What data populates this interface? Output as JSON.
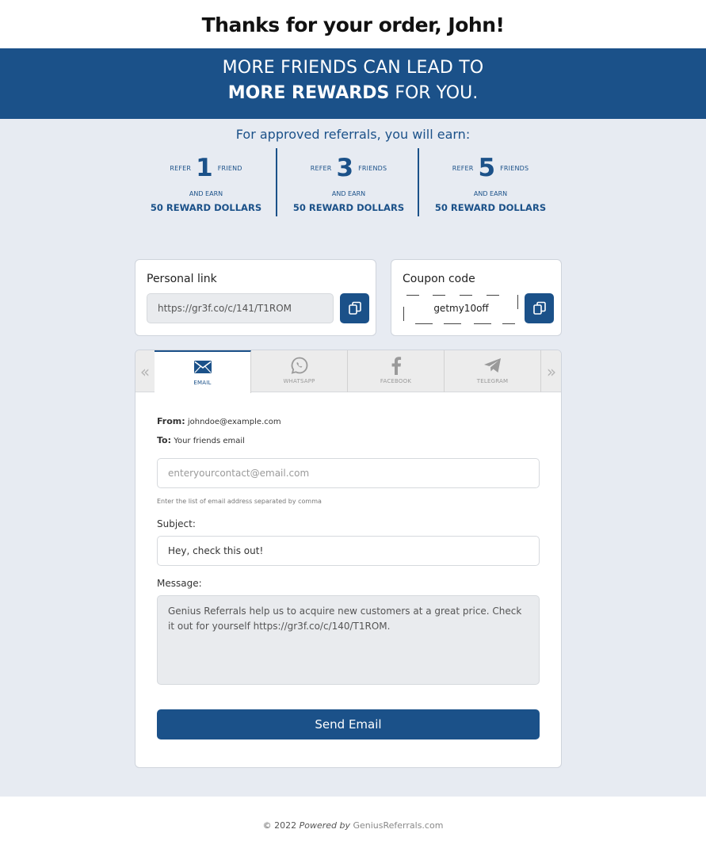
{
  "page": {
    "title": "Thanks for your order, John!"
  },
  "banner": {
    "line1": "MORE FRIENDS CAN LEAD TO",
    "line2_bold": "MORE REWARDS",
    "line2_rest": " FOR YOU."
  },
  "rewards": {
    "intro": "For approved referrals, you will earn:",
    "tiers": [
      {
        "refer": "REFER",
        "count": "1",
        "unit": "FRIEND",
        "and_earn": "AND EARN",
        "reward": "50 REWARD DOLLARS"
      },
      {
        "refer": "REFER",
        "count": "3",
        "unit": "FRIENDS",
        "and_earn": "AND EARN",
        "reward": "50 REWARD DOLLARS"
      },
      {
        "refer": "REFER",
        "count": "5",
        "unit": "FRIENDS",
        "and_earn": "AND EARN",
        "reward": "50 REWARD DOLLARS"
      }
    ]
  },
  "personal_link": {
    "label": "Personal link",
    "value": "https://gr3f.co/c/141/T1ROM",
    "copy_icon": "copy-icon"
  },
  "coupon": {
    "label": "Coupon code",
    "code": "getmy10off",
    "copy_icon": "copy-icon"
  },
  "share": {
    "tabs": [
      {
        "label": "EMAIL",
        "icon": "envelope-icon",
        "active": true
      },
      {
        "label": "WHATSAPP",
        "icon": "whatsapp-icon",
        "active": false
      },
      {
        "label": "FACEBOOK",
        "icon": "facebook-icon",
        "active": false
      },
      {
        "label": "TELEGRAM",
        "icon": "telegram-icon",
        "active": false
      }
    ],
    "prev_arrow": "«",
    "next_arrow": "»"
  },
  "email_form": {
    "from_label": "From:",
    "from_value": "johndoe@example.com",
    "to_label": "To:",
    "to_value": "Your friends email",
    "recipients_placeholder": "enteryourcontact@email.com",
    "hint": "Enter the list of email address separated by comma",
    "subject_label": "Subject:",
    "subject_value": "Hey, check this out!",
    "message_label": "Message:",
    "message_value": "Genius Referrals help us to acquire new customers at a great price. Check it out for yourself https://gr3f.co/c/140/T1ROM.",
    "send_label": "Send Email"
  },
  "footer": {
    "copyright": "© 2022 ",
    "powered": "Powered by",
    "brand": " GeniusReferrals.com"
  },
  "colors": {
    "primary": "#1b5189",
    "background": "#e7ebf2"
  }
}
